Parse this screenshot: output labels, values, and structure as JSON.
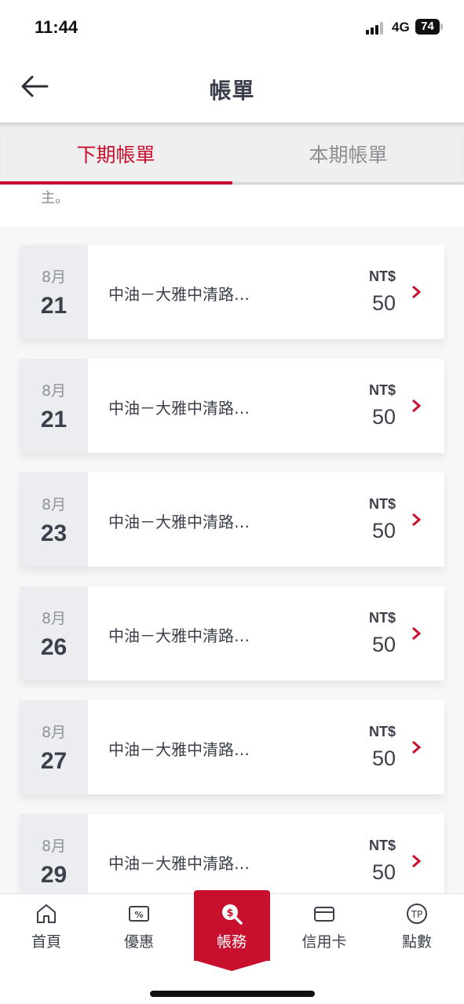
{
  "status_bar": {
    "time": "11:44",
    "network": "4G",
    "battery": "74"
  },
  "header": {
    "title": "帳單",
    "back_icon": "arrow-left-icon"
  },
  "tabs": [
    {
      "label": "下期帳單",
      "active": true
    },
    {
      "label": "本期帳單",
      "active": false
    }
  ],
  "note": "主。",
  "accent_color": "#c8102e",
  "transactions": [
    {
      "month": "8月",
      "day": "21",
      "merchant": "中油－大雅中清路…",
      "currency": "NT$",
      "amount": "50"
    },
    {
      "month": "8月",
      "day": "21",
      "merchant": "中油－大雅中清路…",
      "currency": "NT$",
      "amount": "50"
    },
    {
      "month": "8月",
      "day": "23",
      "merchant": "中油－大雅中清路…",
      "currency": "NT$",
      "amount": "50"
    },
    {
      "month": "8月",
      "day": "26",
      "merchant": "中油－大雅中清路…",
      "currency": "NT$",
      "amount": "50"
    },
    {
      "month": "8月",
      "day": "27",
      "merchant": "中油－大雅中清路…",
      "currency": "NT$",
      "amount": "50"
    },
    {
      "month": "8月",
      "day": "29",
      "merchant": "中油－大雅中清路…",
      "currency": "NT$",
      "amount": "50"
    }
  ],
  "bottom_nav": [
    {
      "label": "首頁",
      "icon": "home-icon"
    },
    {
      "label": "優惠",
      "icon": "discount-icon"
    },
    {
      "label": "帳務",
      "icon": "billing-search-icon",
      "active": true
    },
    {
      "label": "信用卡",
      "icon": "credit-card-icon"
    },
    {
      "label": "點數",
      "icon": "points-icon"
    }
  ]
}
